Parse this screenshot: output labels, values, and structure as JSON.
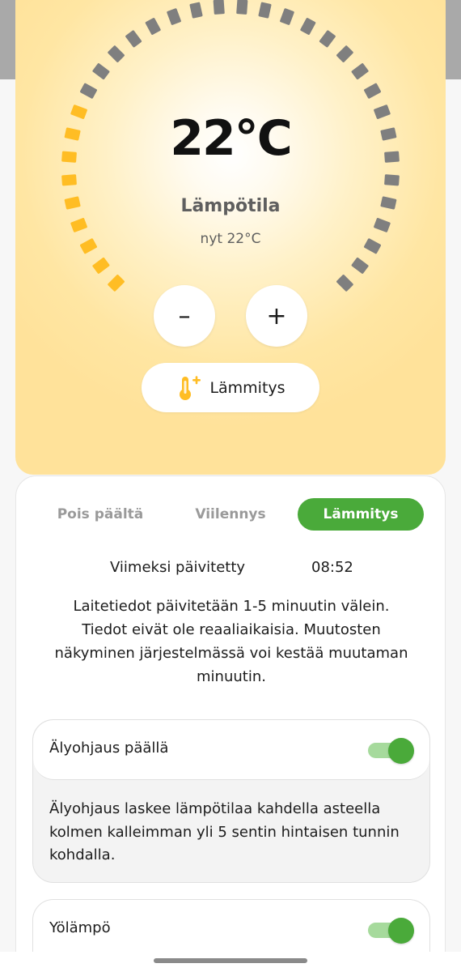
{
  "thermostat": {
    "temperature": "22°C",
    "mode_label": "Lämpötila",
    "current_reading": "nyt 22°C",
    "minus_label": "–",
    "plus_label": "+",
    "heat_button_label": "Lämmitys",
    "heat_icon": "thermometer-plus-icon",
    "active_segments": 9,
    "total_segments": 34,
    "colors": {
      "active": "#ffbd24",
      "inactive": "#7f7f7f"
    }
  },
  "modes": {
    "tabs": [
      {
        "label": "Pois päältä",
        "active": false
      },
      {
        "label": "Viilennys",
        "active": false
      },
      {
        "label": "Lämmitys",
        "active": true
      }
    ],
    "active_color": "#4aaa3a"
  },
  "status": {
    "last_updated_label": "Viimeksi päivitetty",
    "last_updated_time": "08:52",
    "notice": "Laitetiedot päivitetään 1-5 minuutin välein. Tiedot eivät ole reaaliaikaisia. Muutosten näkyminen järjestelmässä voi kestää muutaman minuutin."
  },
  "settings": [
    {
      "label": "Älyohjaus päällä",
      "enabled": true,
      "description": "Älyohjaus laskee lämpötilaa kahdella asteella kolmen kalleimman yli 5 sentin hintaisen tunnin kohdalla."
    },
    {
      "label": "Yölämpö",
      "enabled": true
    }
  ]
}
